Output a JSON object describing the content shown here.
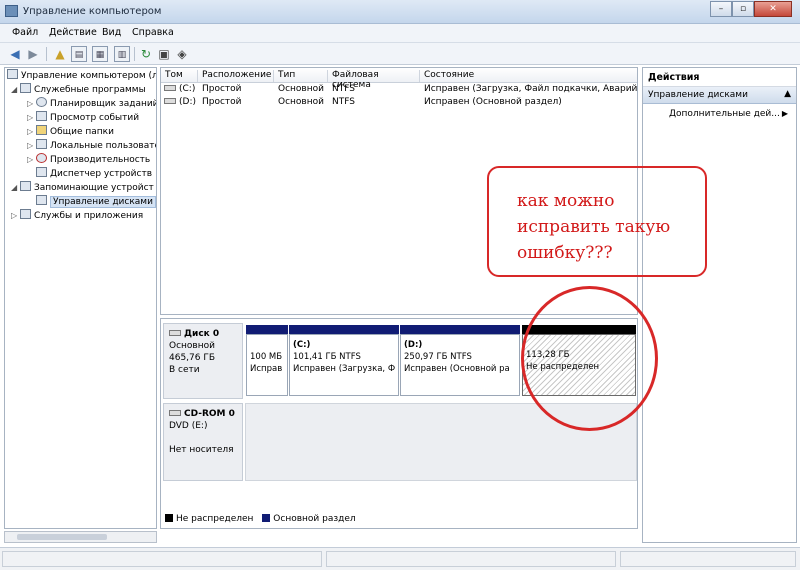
{
  "window": {
    "title": "Управление компьютером",
    "minimize": "–",
    "maximize": "▫",
    "close": "✕"
  },
  "menu": [
    "Файл",
    "Действие",
    "Вид",
    "Справка"
  ],
  "tree": {
    "root": "Управление компьютером (л",
    "items": [
      {
        "label": "Служебные программы"
      },
      {
        "label": "Планировщик заданий"
      },
      {
        "label": "Просмотр событий"
      },
      {
        "label": "Общие папки"
      },
      {
        "label": "Локальные пользовате"
      },
      {
        "label": "Производительность"
      },
      {
        "label": "Диспетчер устройств"
      },
      {
        "label": "Запоминающие устройст"
      },
      {
        "label": "Управление дисками"
      },
      {
        "label": "Службы и приложения"
      }
    ]
  },
  "volumes": {
    "columns": [
      "Том",
      "Расположение",
      "Тип",
      "Файловая система",
      "Состояние"
    ],
    "rows": [
      {
        "volume": "(C:)",
        "layout": "Простой",
        "type": "Основной",
        "fs": "NTFS",
        "status": "Исправен (Загрузка, Файл подкачки, Аварийный"
      },
      {
        "volume": "(D:)",
        "layout": "Простой",
        "type": "Основной",
        "fs": "NTFS",
        "status": "Исправен (Основной раздел)"
      }
    ]
  },
  "disks": {
    "disk0": {
      "name": "Диск 0",
      "type": "Основной",
      "size": "465,76 ГБ",
      "status": "В сети"
    },
    "partitions": [
      {
        "line1": "100 МБ",
        "line2": "Исправ"
      },
      {
        "name": "(C:)",
        "line1": "101,41 ГБ NTFS",
        "line2": "Исправен (Загрузка, Ф"
      },
      {
        "name": "(D:)",
        "line1": "250,97 ГБ NTFS",
        "line2": "Исправен (Основной ра"
      },
      {
        "line1": "113,28 ГБ",
        "line2": "Не распределен"
      }
    ],
    "cdrom": {
      "name": "CD-ROM 0",
      "type": "DVD (E:)",
      "status": "Нет носителя"
    },
    "legend": {
      "unallocated": "Не распределен",
      "primary": "Основной раздел"
    },
    "colors": {
      "primary": "#111c74",
      "unallocated": "#000000"
    }
  },
  "actions": {
    "title": "Действия",
    "group": "Управление дисками",
    "item": "Дополнительные дей..."
  },
  "annotation": {
    "text": "как можно\nисправить такую\nошибку???",
    "color": "#d21919"
  }
}
